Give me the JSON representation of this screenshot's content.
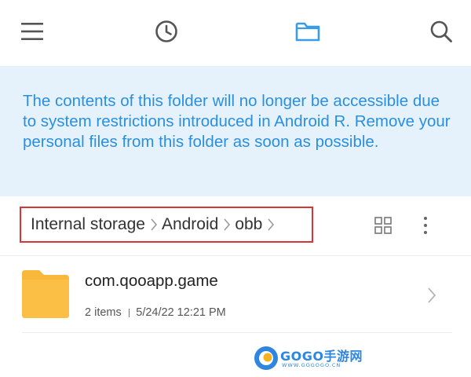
{
  "toolbar": {
    "icons": [
      "menu-icon",
      "history-clock-icon",
      "folder-icon",
      "search-icon"
    ],
    "accent_color": "#3a9ce8",
    "icon_color": "#555555"
  },
  "notice": {
    "text": "The contents of this folder will no longer be accessible due to system restrictions introduced in Android R. Remove your personal files from this folder as soon as possible.",
    "text_color": "#2a8fe0",
    "background": "#e5f2fc"
  },
  "breadcrumb": {
    "items": [
      "Internal storage",
      "Android",
      "obb"
    ],
    "highlight_color": "#d93535"
  },
  "view_controls": {
    "icons": [
      "grid-view-icon",
      "more-options-icon"
    ]
  },
  "files": [
    {
      "name": "com.qooapp.game",
      "item_count": "2 items",
      "modified": "5/24/22 12:21 PM",
      "icon": "folder-icon",
      "icon_color": "#f8b83c"
    }
  ],
  "watermark": {
    "brand": "GOGO手游网",
    "site": "WWW.GOGOGO.CN",
    "color": "#2e86e0"
  }
}
